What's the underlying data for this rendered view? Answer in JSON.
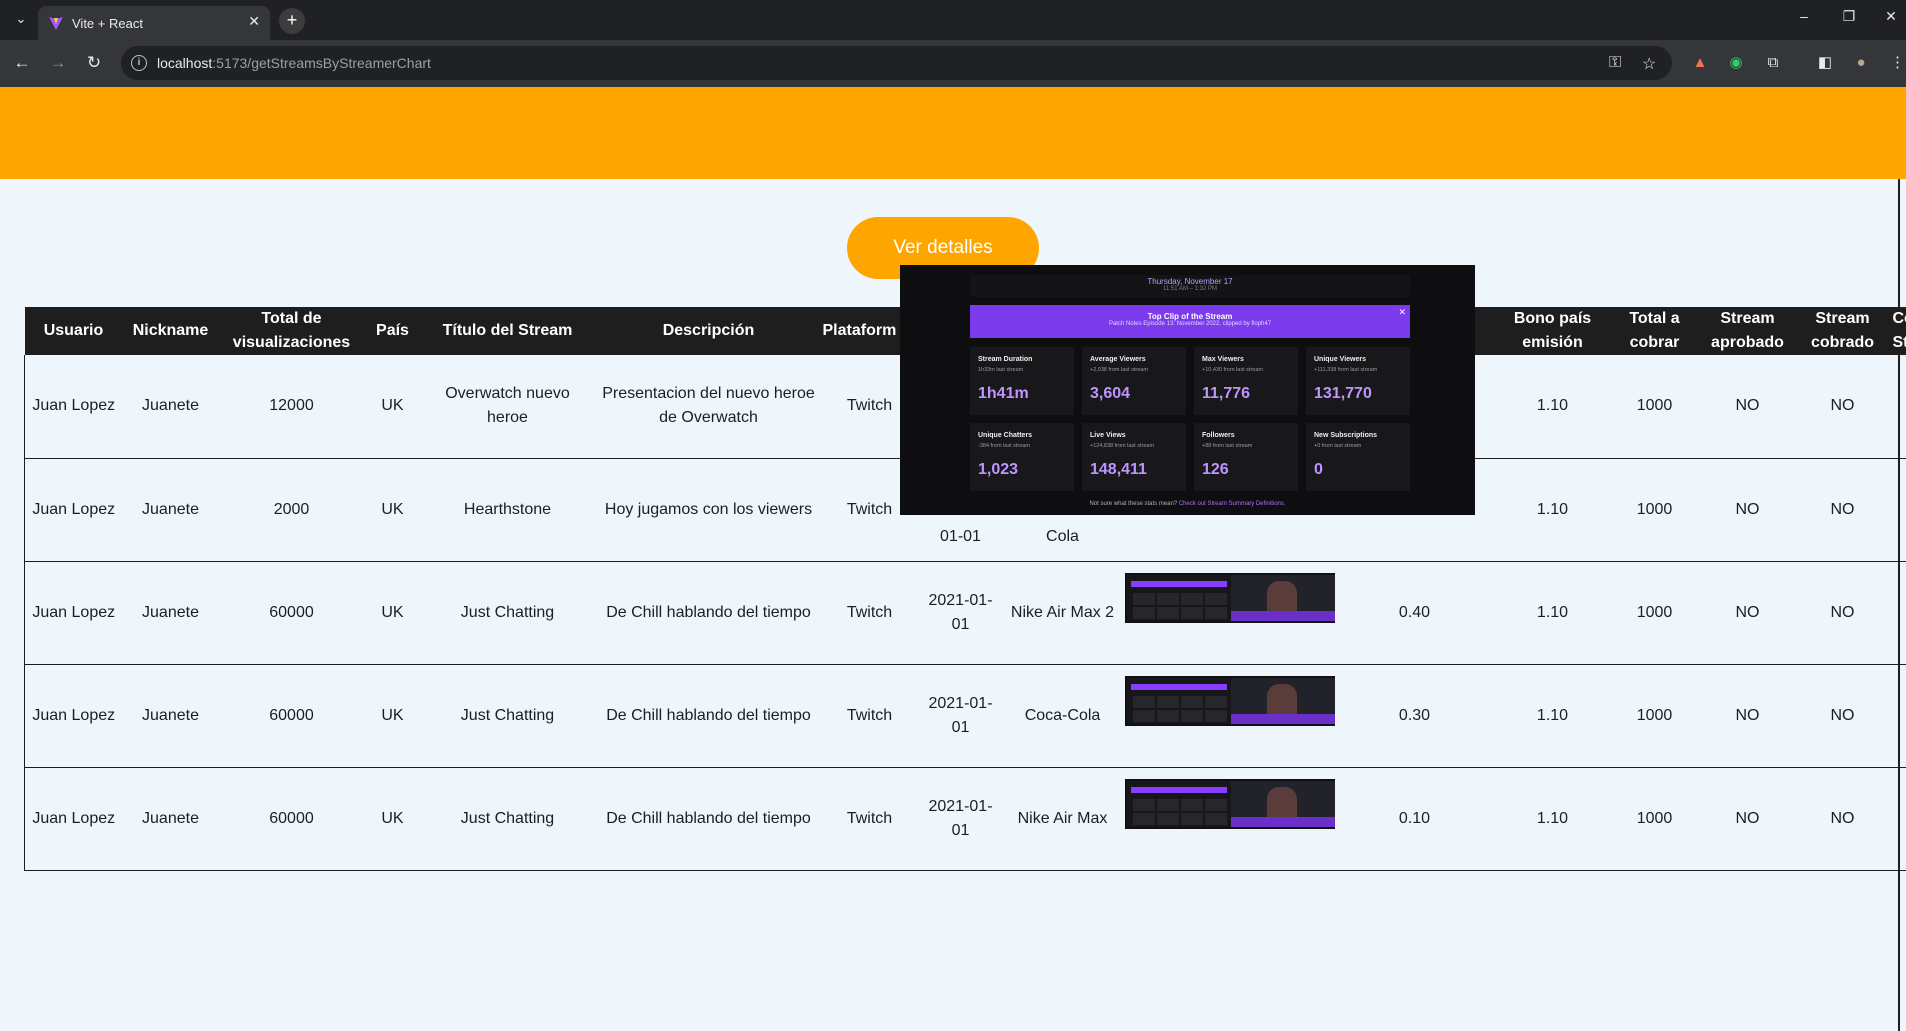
{
  "browser": {
    "tab_title": "Vite + React",
    "url_host": "localhost",
    "url_path": ":5173/getStreamsByStreamerChart"
  },
  "page": {
    "details_button": "Ver detalles"
  },
  "table": {
    "headers": [
      "Usuario",
      "Nickname",
      "Total de visualizaciones",
      "País",
      "Título del Stream",
      "Descripción",
      "Plataform",
      "",
      "",
      "",
      "",
      "Bono país emisión",
      "Total a cobrar",
      "Stream aprobado",
      "Stream cobrado",
      "Co Str"
    ],
    "rows": [
      {
        "usuario": "Juan Lopez",
        "nickname": "Juanete",
        "visualizaciones": "12000",
        "pais": "UK",
        "titulo": "Overwatch nuevo heroe",
        "descripcion": "Presentacion del nuevo heroe de Overwatch",
        "plataforma": "Twitch",
        "fecha": "",
        "sponsor": "",
        "bono_sponsor": "",
        "bono_pais": "1.10",
        "total": "1000",
        "aprobado": "NO",
        "cobrado": "NO"
      },
      {
        "usuario": "Juan Lopez",
        "nickname": "Juanete",
        "visualizaciones": "2000",
        "pais": "UK",
        "titulo": "Hearthstone",
        "descripcion": "Hoy jugamos con los viewers",
        "plataforma": "Twitch",
        "fecha": "01-01",
        "sponsor": "Cola",
        "bono_sponsor": "",
        "bono_pais": "1.10",
        "total": "1000",
        "aprobado": "NO",
        "cobrado": "NO"
      },
      {
        "usuario": "Juan Lopez",
        "nickname": "Juanete",
        "visualizaciones": "60000",
        "pais": "UK",
        "titulo": "Just Chatting",
        "descripcion": "De Chill hablando del tiempo",
        "plataforma": "Twitch",
        "fecha": "2021-01-01",
        "sponsor": "Nike Air Max 2",
        "bono_sponsor": "0.40",
        "bono_pais": "1.10",
        "total": "1000",
        "aprobado": "NO",
        "cobrado": "NO"
      },
      {
        "usuario": "Juan Lopez",
        "nickname": "Juanete",
        "visualizaciones": "60000",
        "pais": "UK",
        "titulo": "Just Chatting",
        "descripcion": "De Chill hablando del tiempo",
        "plataforma": "Twitch",
        "fecha": "2021-01-01",
        "sponsor": "Coca-Cola",
        "bono_sponsor": "0.30",
        "bono_pais": "1.10",
        "total": "1000",
        "aprobado": "NO",
        "cobrado": "NO"
      },
      {
        "usuario": "Juan Lopez",
        "nickname": "Juanete",
        "visualizaciones": "60000",
        "pais": "UK",
        "titulo": "Just Chatting",
        "descripcion": "De Chill hablando del tiempo",
        "plataforma": "Twitch",
        "fecha": "2021-01-01",
        "sponsor": "Nike Air Max",
        "bono_sponsor": "0.10",
        "bono_pais": "1.10",
        "total": "1000",
        "aprobado": "NO",
        "cobrado": "NO"
      }
    ]
  },
  "popover": {
    "date": "Thursday, November 17",
    "time": "11:51 AM – 1:32 PM",
    "clip_title": "Top Clip of the Stream",
    "clip_sub": "Patch Notes Episode 13: November 2022, clipped by floph47",
    "stats": [
      {
        "label": "Stream Duration",
        "sub": "1h33m last stream",
        "value": "1h41m"
      },
      {
        "label": "Average Viewers",
        "sub": "+2,038 from last stream",
        "value": "3,604"
      },
      {
        "label": "Max Viewers",
        "sub": "+10,430 from last stream",
        "value": "11,776"
      },
      {
        "label": "Unique Viewers",
        "sub": "+111,338 from last stream",
        "value": "131,770"
      },
      {
        "label": "Unique Chatters",
        "sub": "-384 from last stream",
        "value": "1,023"
      },
      {
        "label": "Live Views",
        "sub": "+124,838 from last stream",
        "value": "148,411"
      },
      {
        "label": "Followers",
        "sub": "+88 from last stream",
        "value": "126"
      },
      {
        "label": "New Subscriptions",
        "sub": "+0 from last stream",
        "value": "0"
      }
    ],
    "footer_q": "Not sure what these stats mean?",
    "footer_link": "Check out Stream Summary Definitions."
  }
}
